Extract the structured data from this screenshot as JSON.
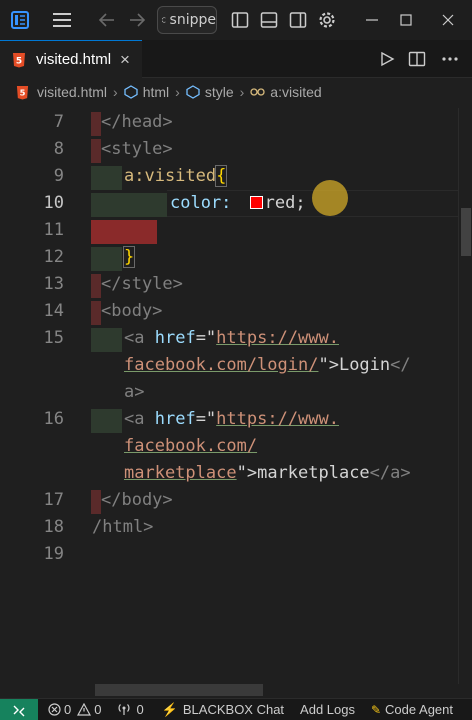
{
  "titlebar": {
    "search_text": "snippe",
    "icons": [
      "app-logo-icon",
      "menu-icon",
      "back-icon",
      "forward-icon",
      "search-icon",
      "toggle-sidebar-icon",
      "toggle-panel-icon",
      "toggle-secondary-sidebar-icon",
      "settings-icon",
      "minimize-icon",
      "maximize-icon",
      "close-icon"
    ]
  },
  "tab": {
    "label": "visited.html",
    "close": "×",
    "icon_text": "5"
  },
  "breadcrumb": {
    "items": [
      "visited.html",
      "html",
      "style",
      "a:visited"
    ]
  },
  "editor": {
    "line_numbers": [
      "7",
      "8",
      "9",
      "10",
      "11",
      "12",
      "13",
      "14",
      "15",
      "",
      "",
      "16",
      "",
      "",
      "17",
      "18",
      "19"
    ],
    "active_line": "10",
    "lines": {
      "l7": "</head>",
      "l8": "<style>",
      "l9_sel": "a:visited",
      "l9_brace": "{",
      "l10_prop": "color:",
      "l10_val": "red;",
      "l12_brace": "}",
      "l13": "</style>",
      "l14": "<body>",
      "l15_a": "<a",
      "l15_attr": "href",
      "l15_eq": "=\"",
      "l15_url1": "https://www.",
      "l15_url2": "facebook.com/login/",
      "l15_close": "\">",
      "l15_text": "Login",
      "l15_end1": "</",
      "l15_end2": "a>",
      "l16_a": "<a",
      "l16_attr": "href",
      "l16_eq": "=\"",
      "l16_url1": "https://www.",
      "l16_url2": "facebook.com/",
      "l16_url3": "marketplace",
      "l16_close": "\">",
      "l16_text": "marketplace",
      "l16_end": "</a>",
      "l17": "</body>",
      "l18": "/html>"
    },
    "color_swatch": "#ff0000"
  },
  "statusbar": {
    "errors": "0",
    "warnings": "0",
    "ports": "0",
    "blackbox": "BLACKBOX Chat",
    "add_logs": "Add Logs",
    "code_agent": "Code Agent"
  },
  "colors": {
    "accent": "#0078d4",
    "remote": "#16825d",
    "html_icon": "#e44d26"
  }
}
